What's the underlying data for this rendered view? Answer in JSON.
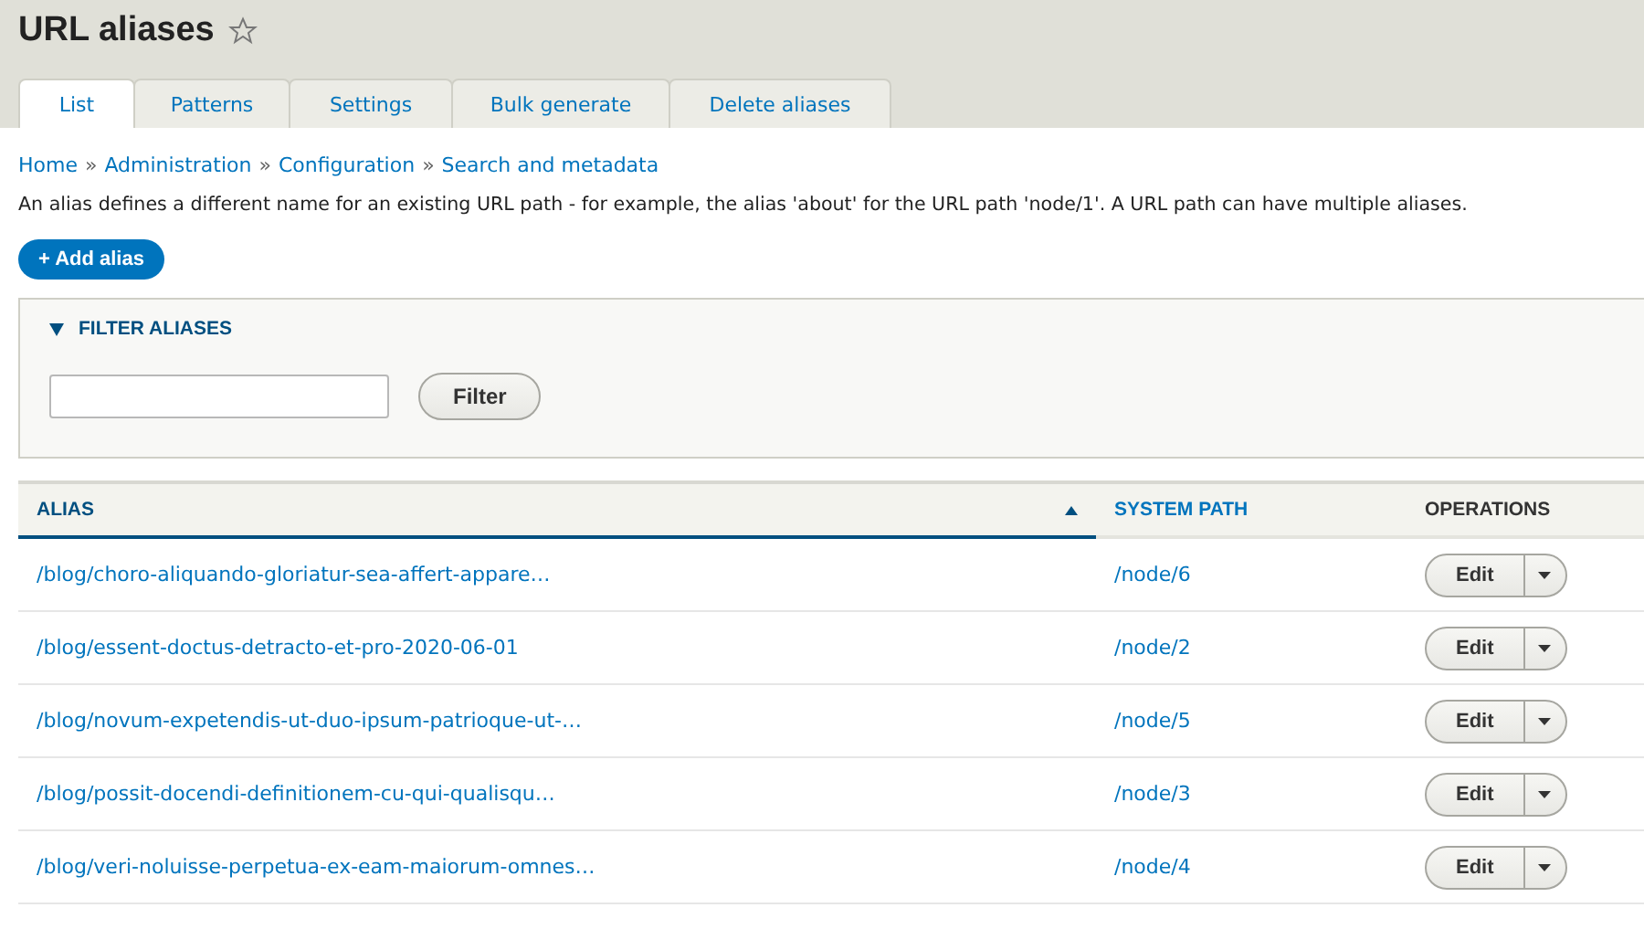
{
  "page": {
    "title": "URL aliases",
    "favorite": false
  },
  "tabs": [
    {
      "label": "List",
      "selected": true
    },
    {
      "label": "Patterns",
      "selected": false
    },
    {
      "label": "Settings",
      "selected": false
    },
    {
      "label": "Bulk generate",
      "selected": false
    },
    {
      "label": "Delete aliases",
      "selected": false
    }
  ],
  "breadcrumb": {
    "separator": "»",
    "items": [
      "Home",
      "Administration",
      "Configuration",
      "Search and metadata"
    ]
  },
  "description": "An alias defines a different name for an existing URL path - for example, the alias 'about' for the URL path 'node/1'. A URL path can have multiple aliases.",
  "add_button": "+ Add alias",
  "filter": {
    "legend": "FILTER ALIASES",
    "expanded": true,
    "button": "Filter"
  },
  "table": {
    "columns": [
      {
        "label": "ALIAS",
        "kind": "sortable",
        "sorted": true
      },
      {
        "label": "SYSTEM PATH",
        "kind": "sortable",
        "sorted": false
      },
      {
        "label": "OPERATIONS",
        "kind": "plain",
        "sorted": false
      }
    ],
    "rows": [
      {
        "alias": "/blog/choro-aliquando-gloriatur-sea-affert-appare…",
        "path": "/node/6",
        "operation": "Edit"
      },
      {
        "alias": "/blog/essent-doctus-detracto-et-pro-2020-06-01",
        "path": "/node/2",
        "operation": "Edit"
      },
      {
        "alias": "/blog/novum-expetendis-ut-duo-ipsum-patrioque-ut-…",
        "path": "/node/5",
        "operation": "Edit"
      },
      {
        "alias": "/blog/possit-docendi-definitionem-cu-qui-qualisqu…",
        "path": "/node/3",
        "operation": "Edit"
      },
      {
        "alias": "/blog/veri-noluisse-perpetua-ex-eam-maiorum-omnes…",
        "path": "/node/4",
        "operation": "Edit"
      }
    ]
  }
}
